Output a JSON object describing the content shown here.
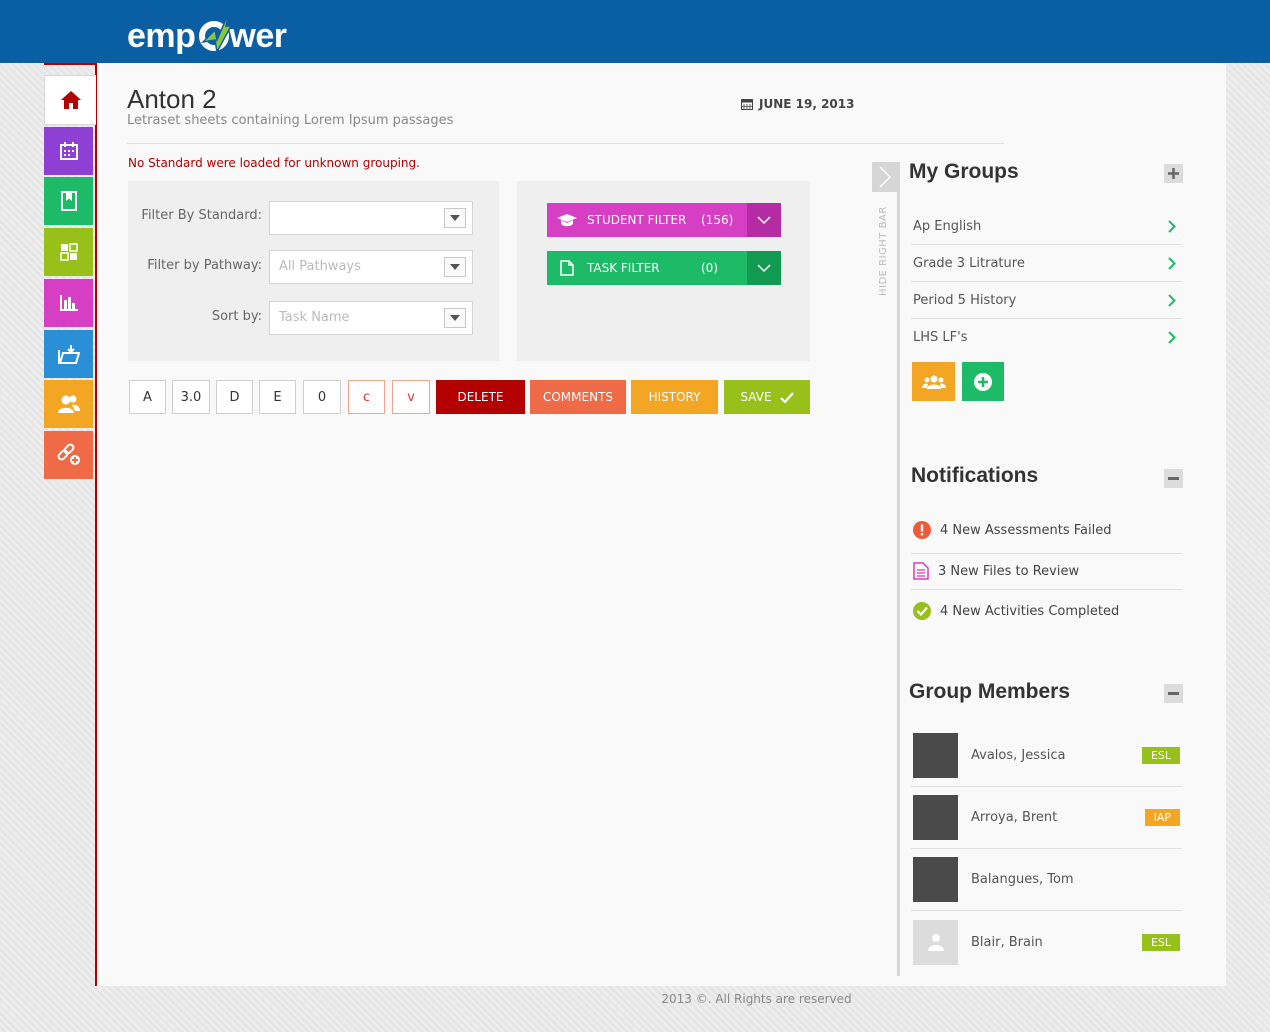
{
  "brand": {
    "logo_text_left": "emp",
    "logo_text_right": "wer"
  },
  "page": {
    "title": "Anton 2",
    "subtitle": "Letraset sheets containing Lorem Ipsum passages",
    "date": "JUNE 19, 2013",
    "warning": "No Standard were loaded for unknown grouping."
  },
  "nav": [
    {
      "name": "home",
      "color": "#ffffff"
    },
    {
      "name": "calendar",
      "color": "#8e3fd4"
    },
    {
      "name": "bookmark",
      "color": "#1dbb68"
    },
    {
      "name": "dashboard",
      "color": "#98c01a"
    },
    {
      "name": "reports",
      "color": "#d63ec4"
    },
    {
      "name": "upload",
      "color": "#2b8fd8"
    },
    {
      "name": "users",
      "color": "#f2a624"
    },
    {
      "name": "link",
      "color": "#ef6a46"
    }
  ],
  "filters": {
    "standard_label": "Filter By Standard:",
    "standard_value": "",
    "pathway_label": "Filter by Pathway:",
    "pathway_placeholder": "All Pathways",
    "sort_label": "Sort by:",
    "sort_placeholder": "Task Name",
    "student_filter": {
      "label": "STUDENT FILTER",
      "count": "(156)",
      "color": "#d63ec4",
      "dark": "#b52ba4"
    },
    "task_filter": {
      "label": "TASK FILTER",
      "count": "(0)",
      "color": "#1dbb68",
      "dark": "#139a52"
    }
  },
  "grades": [
    "A",
    "3.0",
    "D",
    "E",
    "0",
    "c",
    "v"
  ],
  "actions": {
    "delete": {
      "label": "DELETE",
      "color": "#b30000"
    },
    "comments": {
      "label": "COMMENTS",
      "color": "#ef6a46"
    },
    "history": {
      "label": "HISTORY",
      "color": "#f2a624"
    },
    "save": {
      "label": "SAVE",
      "color": "#98c01a"
    }
  },
  "right_bar": {
    "hide_label": "HIDE RIGHT BAR"
  },
  "my_groups": {
    "title": "My Groups",
    "items": [
      "Ap English",
      "Grade 3 Litrature",
      "Period 5 History",
      "LHS LF's"
    ]
  },
  "notifications": {
    "title": "Notifications",
    "items": [
      {
        "text": "4 New Assessments Failed",
        "icon": "alert-icon",
        "color": "#ef5a3a"
      },
      {
        "text": "3 New Files to Review",
        "icon": "file-icon",
        "color": "#d63ec4"
      },
      {
        "text": "4 New Activities Completed",
        "icon": "check-icon",
        "color": "#98c01a"
      }
    ]
  },
  "group_members": {
    "title": "Group Members",
    "items": [
      {
        "name": "Avalos, Jessica",
        "badge": "ESL",
        "badge_color": "#98c01a"
      },
      {
        "name": "Arroya, Brent",
        "badge": "IAP",
        "badge_color": "#f2a624"
      },
      {
        "name": "Balangues, Tom",
        "badge": "",
        "badge_color": ""
      },
      {
        "name": "Blair, Brain",
        "badge": "ESL",
        "badge_color": "#98c01a"
      }
    ]
  },
  "footer": {
    "text": "2013 ©. All Rights are reserved"
  }
}
